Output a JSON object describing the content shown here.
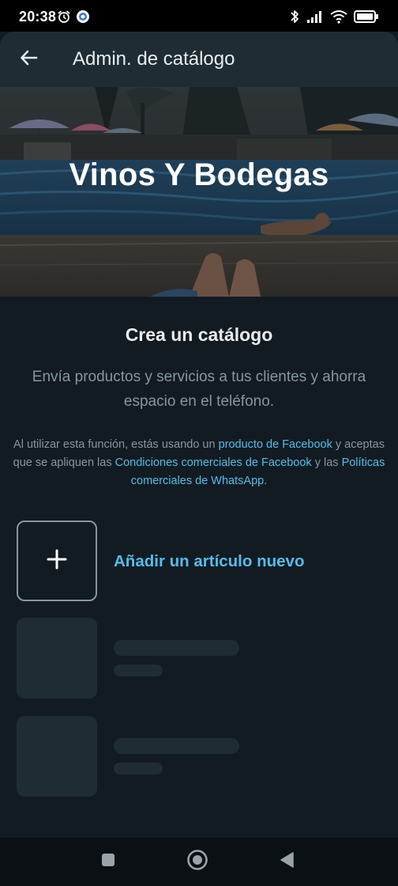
{
  "status_bar": {
    "time": "20:38",
    "icons_left": [
      "alarm-icon",
      "app-notification-icon"
    ],
    "icons_right": [
      "bluetooth-icon",
      "signal-icon",
      "wifi-icon",
      "battery-icon"
    ]
  },
  "app_bar": {
    "title": "Admin. de catálogo",
    "back_icon": "arrow-left-icon"
  },
  "hero": {
    "business_name": "Vinos Y Bodegas"
  },
  "intro": {
    "title": "Crea un catálogo",
    "description": "Envía productos y servicios a tus clientes y ahorra espacio en el teléfono."
  },
  "legal": {
    "part1": "Al utilizar esta función, estás usando un ",
    "link1": "producto de Facebook",
    "part2": " y aceptas que se apliquen las ",
    "link2": "Condiciones comerciales de Facebook",
    "part3": " y las ",
    "link3": "Políticas comerciales de WhatsApp",
    "part4": "."
  },
  "add_item": {
    "label": "Añadir un artículo nuevo",
    "icon": "plus-icon"
  },
  "colors": {
    "background": "#121b22",
    "app_bar": "#1f2c34",
    "accent_link": "#53bdeb",
    "secondary_text": "#8696a0",
    "primary_text": "#e9edef"
  },
  "nav_bar": {
    "buttons": [
      "recents-square-icon",
      "home-circle-icon",
      "back-triangle-icon"
    ]
  }
}
